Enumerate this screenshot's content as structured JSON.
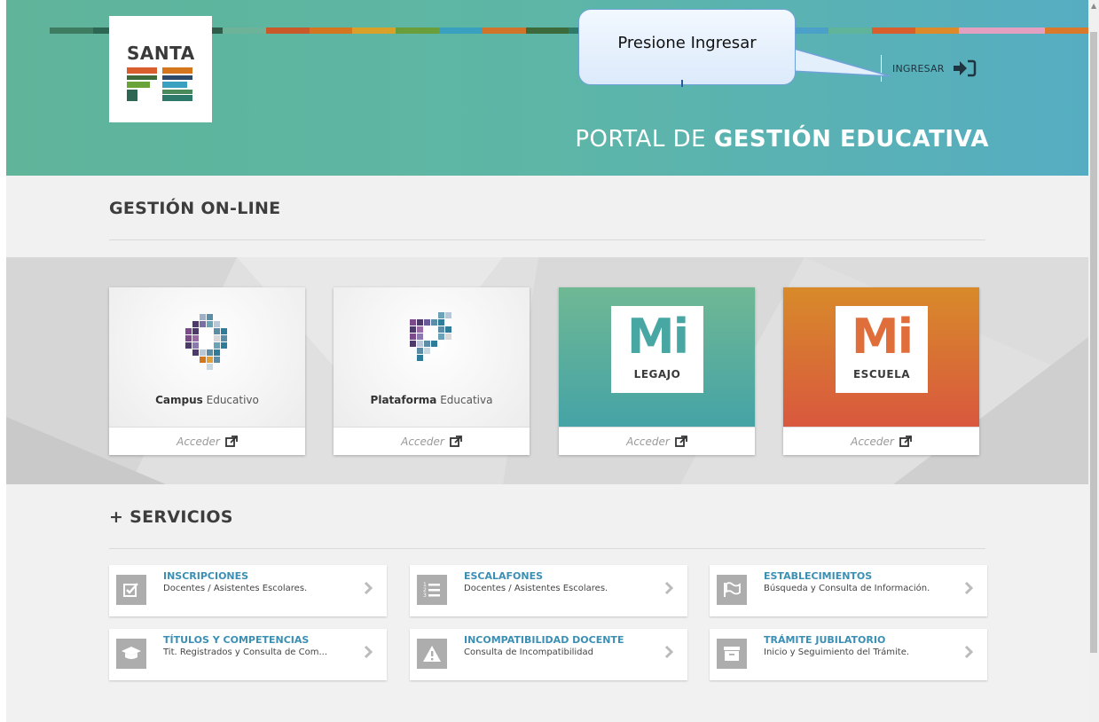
{
  "colors": {
    "accent_teal": "#5db6a6",
    "link_blue": "#3b8fb4",
    "legajo_green": "#48a6a3",
    "escuela_orange": "#df6e3a"
  },
  "header": {
    "logo_top": "SANTA",
    "logo_bottom": "FE",
    "login_label": "INGRESAR",
    "login_icon": "sign-in-icon",
    "portal_prefix": "PORTAL DE",
    "portal_bold": "GESTIÓN EDUCATIVA"
  },
  "callout": {
    "text": "Presione  Ingresar"
  },
  "online": {
    "title": "GESTIÓN ON-LINE",
    "cards": [
      {
        "bold": "Campus",
        "rest": " Educativo",
        "action": "Acceder",
        "icon": "external-link-icon"
      },
      {
        "bold": "Plataforma",
        "rest": " Educativa",
        "action": "Acceder",
        "icon": "external-link-icon"
      },
      {
        "mi": "Mi",
        "label": "LEGAJO",
        "action": "Acceder",
        "icon": "external-link-icon"
      },
      {
        "mi": "Mi",
        "label": "ESCUELA",
        "action": "Acceder",
        "icon": "external-link-icon"
      }
    ]
  },
  "services": {
    "title": "+ SERVICIOS",
    "items": [
      {
        "title": "INSCRIPCIONES",
        "subtitle": "Docentes / Asistentes Escolares.",
        "icon": "checkbox-icon"
      },
      {
        "title": "ESCALAFONES",
        "subtitle": "Docentes / Asistentes Escolares.",
        "icon": "numbered-list-icon"
      },
      {
        "title": "ESTABLECIMIENTOS",
        "subtitle": "Búsqueda y Consulta de Información.",
        "icon": "flag-icon"
      },
      {
        "title": "TÍTULOS Y COMPETENCIAS",
        "subtitle": "Tit. Registrados y Consulta de Com...",
        "icon": "graduation-cap-icon"
      },
      {
        "title": "INCOMPATIBILIDAD DOCENTE",
        "subtitle": "Consulta de Incompatibilidad",
        "icon": "warning-icon"
      },
      {
        "title": "TRÁMITE JUBILATORIO",
        "subtitle": "Inicio y Seguimiento del Trámite.",
        "icon": "archive-icon"
      }
    ]
  }
}
